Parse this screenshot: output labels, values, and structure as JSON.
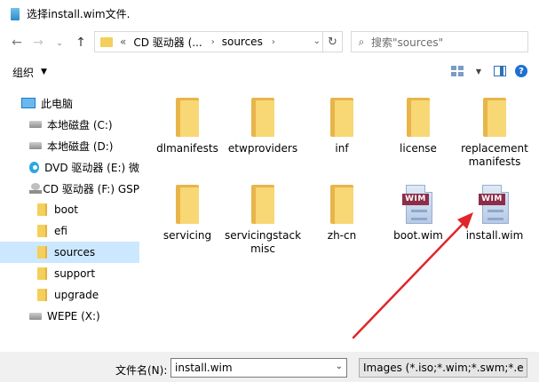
{
  "window": {
    "title": "选择install.wim文件."
  },
  "nav": {
    "back_icon": "back-arrow-icon",
    "forward_icon": "forward-arrow-icon",
    "recent_icon": "chevron-down-icon",
    "up_icon": "up-arrow-icon"
  },
  "address": {
    "overflow": "«",
    "crumb1": "CD 驱动器 (...",
    "sep": "›",
    "crumb2": "sources",
    "sep2": "›"
  },
  "search": {
    "placeholder": "搜索\"sources\""
  },
  "toolbar": {
    "organize_label": "组织"
  },
  "sidebar": {
    "items": [
      {
        "label": "此电脑",
        "icon": "computer-icon"
      },
      {
        "label": "本地磁盘 (C:)",
        "icon": "drive-icon"
      },
      {
        "label": "本地磁盘 (D:)",
        "icon": "drive-icon"
      },
      {
        "label": "DVD 驱动器 (E:) 微",
        "icon": "dvd-icon"
      },
      {
        "label": "CD 驱动器 (F:) GSP",
        "icon": "cd-drive-icon"
      },
      {
        "label": "boot",
        "icon": "folder-icon"
      },
      {
        "label": "efi",
        "icon": "folder-icon"
      },
      {
        "label": "sources",
        "icon": "folder-icon",
        "selected": true
      },
      {
        "label": "support",
        "icon": "folder-icon"
      },
      {
        "label": "upgrade",
        "icon": "folder-icon"
      },
      {
        "label": "WEPE (X:)",
        "icon": "drive-icon"
      }
    ]
  },
  "files": [
    {
      "name": "dlmanifests",
      "type": "folder"
    },
    {
      "name": "etwproviders",
      "type": "folder"
    },
    {
      "name": "inf",
      "type": "folder"
    },
    {
      "name": "license",
      "type": "folder"
    },
    {
      "name": "replacementmanifests",
      "type": "folder"
    },
    {
      "name": "servicing",
      "type": "folder"
    },
    {
      "name": "servicingstackmisc",
      "type": "folder"
    },
    {
      "name": "zh-cn",
      "type": "folder"
    },
    {
      "name": "boot.wim",
      "type": "wim",
      "badge": "WIM"
    },
    {
      "name": "install.wim",
      "type": "wim",
      "badge": "WIM"
    }
  ],
  "bottom": {
    "filename_label": "文件名(N):",
    "filename_value": "install.wim",
    "filter_value": "Images (*.iso;*.wim;*.swm;*.e"
  },
  "colors": {
    "selection": "#cce8ff",
    "arrow": "#e0262b",
    "folder": "#f8d775",
    "wim_badge": "#8d2d48"
  }
}
